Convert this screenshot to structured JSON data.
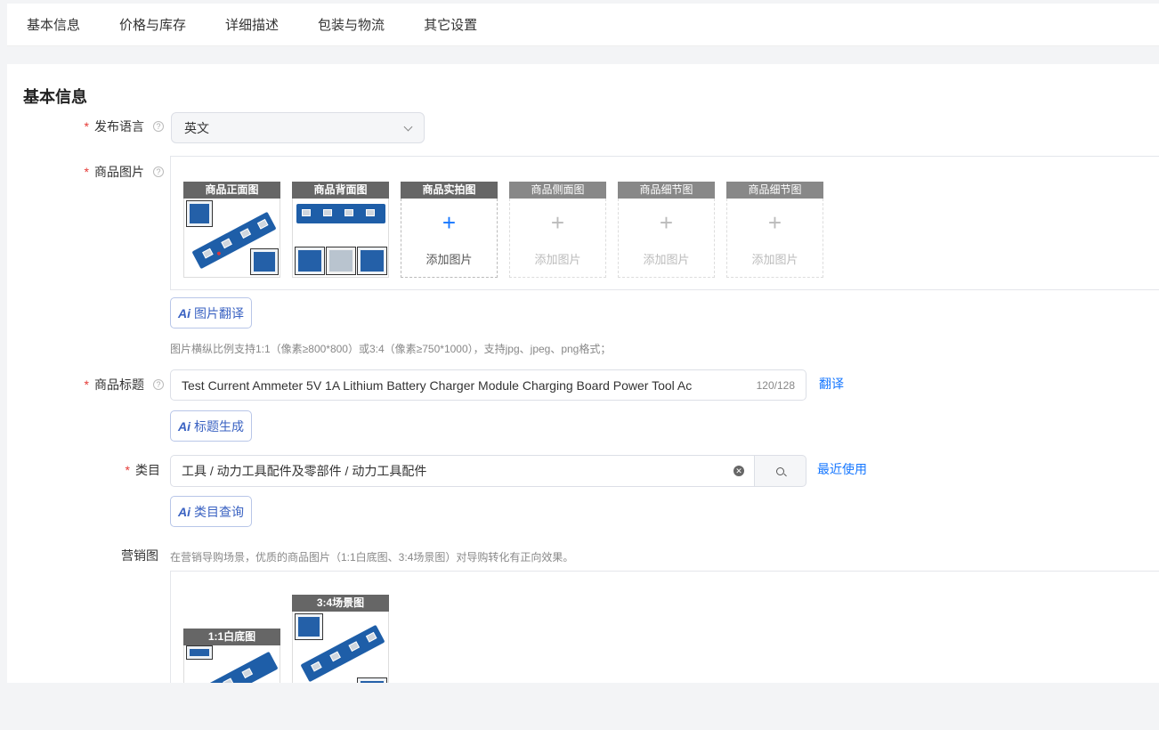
{
  "tabs": [
    "基本信息",
    "价格与库存",
    "详细描述",
    "包装与物流",
    "其它设置"
  ],
  "section_title": "基本信息",
  "language": {
    "label": "发布语言",
    "value": "英文",
    "help_icon": "question-circle-icon",
    "chevron_icon": "chevron-down-icon"
  },
  "images": {
    "label": "商品图片",
    "slots": [
      {
        "caption": "商品正面图",
        "state": "filled"
      },
      {
        "caption": "商品背面图",
        "state": "filled"
      },
      {
        "caption": "商品实拍图",
        "state": "add",
        "add_text": "添加图片"
      },
      {
        "caption": "商品侧面图",
        "state": "empty",
        "add_text": "添加图片"
      },
      {
        "caption": "商品细节图",
        "state": "empty",
        "add_text": "添加图片"
      },
      {
        "caption": "商品细节图",
        "state": "empty",
        "add_text": "添加图片"
      }
    ],
    "ai_button": "图片翻译",
    "hint": "图片横纵比例支持1:1（像素≥800*800）或3:4（像素≥750*1000），支持jpg、jpeg、png格式；"
  },
  "title": {
    "label": "商品标题",
    "value": "Test Current Ammeter 5V 1A Lithium Battery Charger Module Charging Board Power Tool Ac",
    "count": "120/128",
    "translate_link": "翻译",
    "ai_button": "标题生成"
  },
  "category": {
    "label": "类目",
    "value": "工具 / 动力工具配件及零部件 / 动力工具配件",
    "recent_link": "最近使用",
    "ai_button": "类目查询"
  },
  "marketing": {
    "label": "营销图",
    "hint": "在营销导购场景，优质的商品图片（1:1白底图、3:4场景图）对导购转化有正向效果。",
    "slots": [
      {
        "caption": "1:1白底图"
      },
      {
        "caption": "3:4场景图"
      }
    ]
  },
  "ai_icon_text": "Ai",
  "colors": {
    "accent": "#1677ff",
    "required": "#e53935",
    "ai": "#3a62c2"
  }
}
